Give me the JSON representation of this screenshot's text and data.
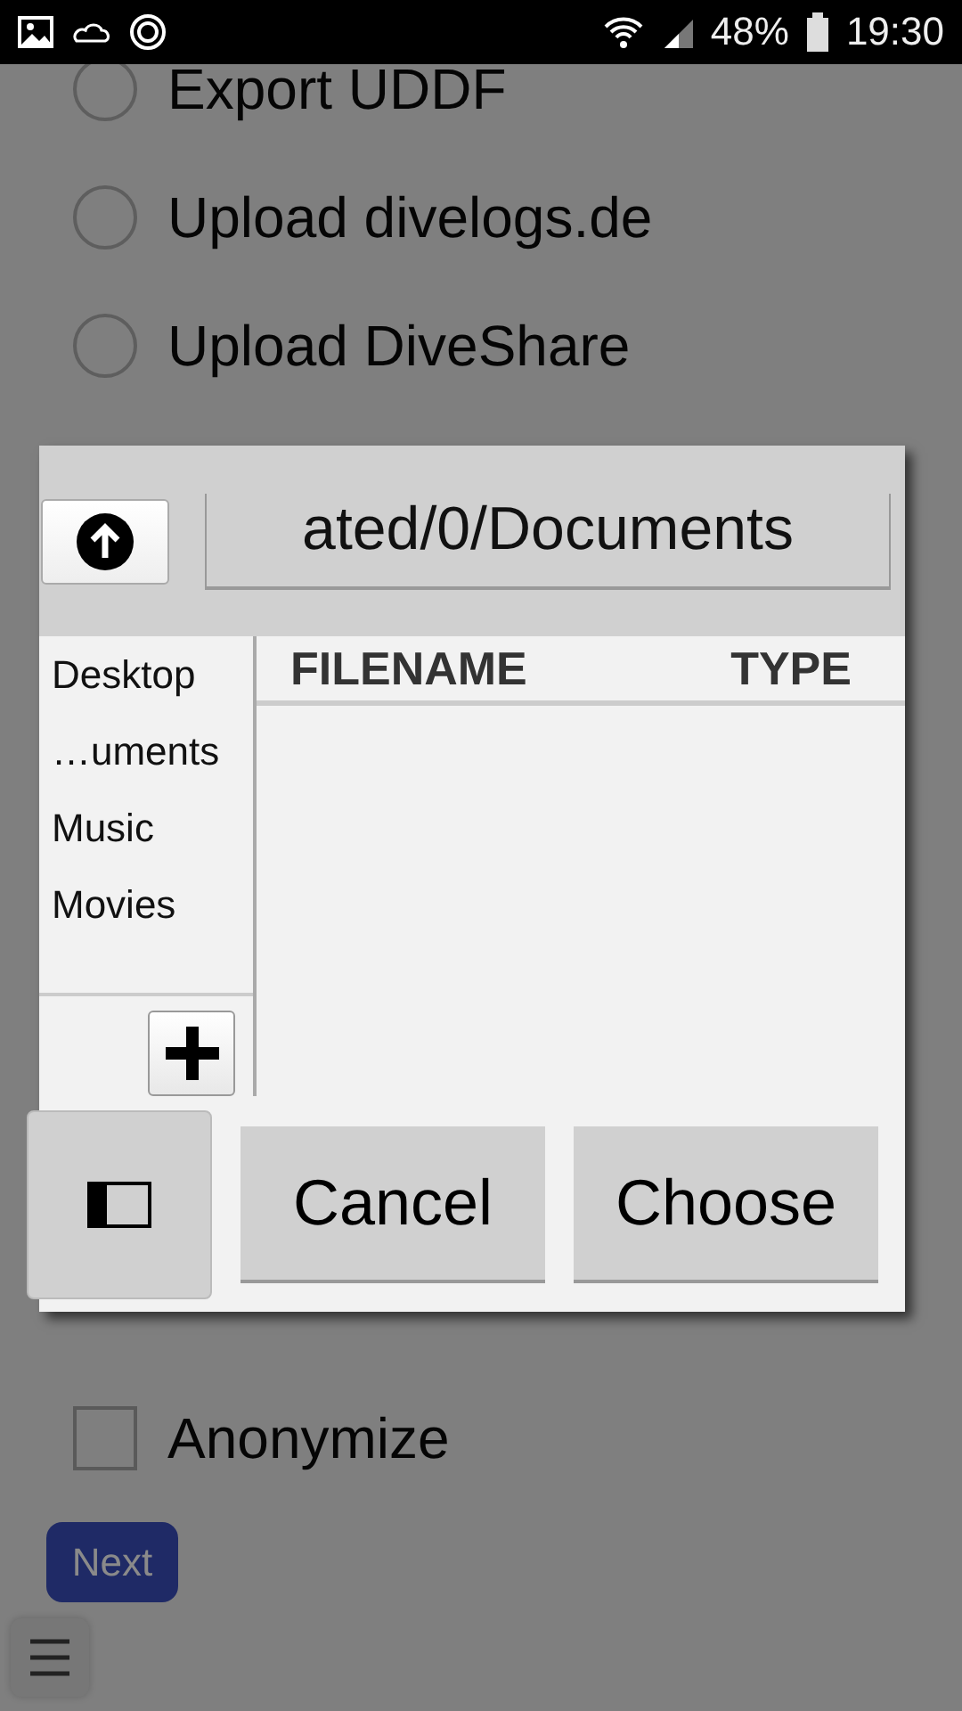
{
  "status_bar": {
    "battery": "48%",
    "time": "19:30"
  },
  "options": [
    {
      "label": "Export UDDF",
      "selected": false
    },
    {
      "label": "Upload divelogs.de",
      "selected": false
    },
    {
      "label": "Upload DiveShare",
      "selected": false
    }
  ],
  "anonymize": {
    "label": "Anonymize",
    "checked": false
  },
  "next_button": "Next",
  "dialog": {
    "path": "ated/0/Documents",
    "places": [
      "Desktop",
      "…uments",
      "Music",
      "Movies"
    ],
    "columns": [
      "FILENAME",
      "TYPE"
    ],
    "buttons": [
      "Cancel",
      "Choose"
    ]
  }
}
